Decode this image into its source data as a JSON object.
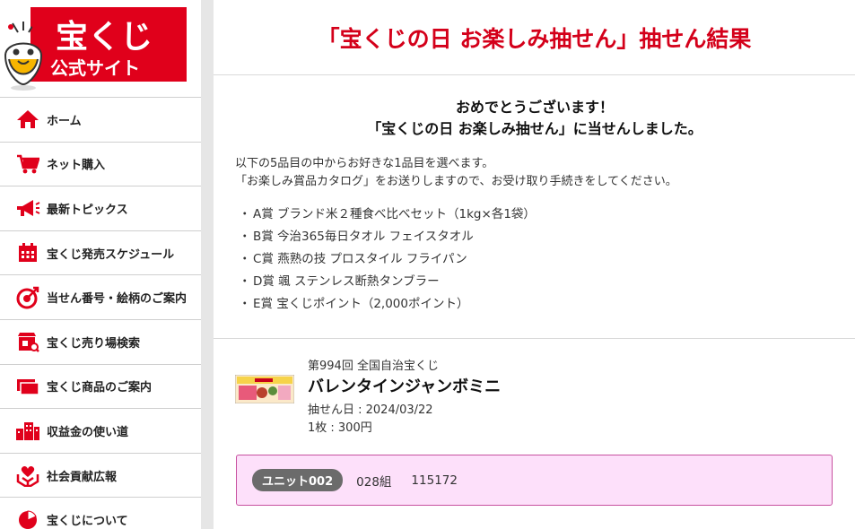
{
  "logo": {
    "line1": "宝くじ",
    "line2": "公式サイト"
  },
  "sidebar": {
    "items": [
      {
        "label": "ホーム",
        "icon": "home-icon"
      },
      {
        "label": "ネット購入",
        "icon": "cart-icon"
      },
      {
        "label": "最新トピックス",
        "icon": "megaphone-icon"
      },
      {
        "label": "宝くじ発売スケジュール",
        "icon": "calendar-icon"
      },
      {
        "label": "当せん番号・絵柄のご案内",
        "icon": "target-icon"
      },
      {
        "label": "宝くじ売り場検索",
        "icon": "store-icon"
      },
      {
        "label": "宝くじ商品のご案内",
        "icon": "tickets-icon"
      },
      {
        "label": "収益金の使い道",
        "icon": "buildings-icon"
      },
      {
        "label": "社会貢献広報",
        "icon": "heart-hands-icon"
      },
      {
        "label": "宝くじについて",
        "icon": "pie-chart-icon"
      }
    ]
  },
  "main": {
    "title": "「宝くじの日 お楽しみ抽せん」抽せん結果",
    "congrats": {
      "line1": "おめでとうございます！",
      "line2": "「宝くじの日 お楽しみ抽せん」に当せんしました。",
      "desc1": "以下の5品目の中からお好きな1品目を選べます。",
      "desc2": "「お楽しみ賞品カタログ」をお送りしますので、お受け取り手続きをしてください。",
      "bullet": "・",
      "prizes": [
        "A賞 ブランド米２種食べ比べセット（1kg×各1袋）",
        "B賞 今治365毎日タオル フェイスタオル",
        "C賞 燕熟の技 プロスタイル フライパン",
        "D賞 颯 ステンレス断熱タンブラー",
        "E賞 宝くじポイント（2,000ポイント）"
      ]
    },
    "lottery": {
      "round": "第994回 全国自治宝くじ",
      "name": "バレンタインジャンボミニ",
      "draw_date": "抽せん日 : 2024/03/22",
      "price": "1枚 : 300円",
      "unit": "ユニット002",
      "group": "028組",
      "number": "115172"
    }
  },
  "colors": {
    "brand_red": "#e0001b",
    "title_red": "#d4001a",
    "result_bg": "#fde0fa",
    "result_border": "#c7519f",
    "badge_gray": "#6b6b6b"
  }
}
